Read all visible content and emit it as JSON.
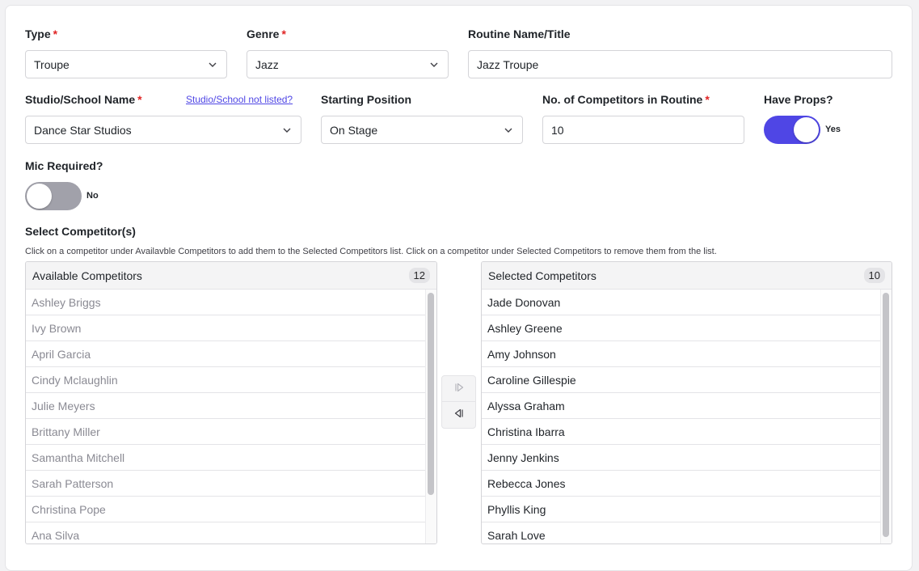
{
  "form": {
    "type": {
      "label": "Type",
      "required_mark": "*",
      "value": "Troupe"
    },
    "genre": {
      "label": "Genre",
      "required_mark": "*",
      "value": "Jazz"
    },
    "routine_name": {
      "label": "Routine Name/Title",
      "value": "Jazz Troupe"
    },
    "studio": {
      "label": "Studio/School Name",
      "required_mark": "*",
      "value": "Dance Star Studios",
      "not_listed_link": "Studio/School not listed?"
    },
    "starting_position": {
      "label": "Starting Position",
      "value": "On Stage"
    },
    "num_competitors": {
      "label": "No. of Competitors in Routine",
      "required_mark": "*",
      "value": "10"
    },
    "have_props": {
      "label": "Have Props?",
      "state": "Yes",
      "on": true,
      "color_on": "#4f46e5"
    },
    "mic_required": {
      "label": "Mic Required?",
      "state": "No",
      "on": false,
      "color_off": "#a1a1aa"
    }
  },
  "competitors": {
    "title": "Select Competitor(s)",
    "help": "Click on a competitor under Availavble Competitors to add them to the Selected Competitors list. Click on a competitor under Selected Competitors to remove them from the list.",
    "available": {
      "title": "Available Competitors",
      "count": "12",
      "items": [
        "Ashley Briggs",
        "Ivy Brown",
        "April Garcia",
        "Cindy Mclaughlin",
        "Julie Meyers",
        "Brittany Miller",
        "Samantha Mitchell",
        "Sarah Patterson",
        "Christina Pope",
        "Ana Silva"
      ]
    },
    "selected": {
      "title": "Selected Competitors",
      "count": "10",
      "items": [
        "Jade Donovan",
        "Ashley Greene",
        "Amy Johnson",
        "Caroline Gillespie",
        "Alyssa Graham",
        "Christina Ibarra",
        "Jenny Jenkins",
        "Rebecca Jones",
        "Phyllis King",
        "Sarah Love"
      ]
    },
    "move_right_icon": "move-right-icon",
    "move_left_icon": "move-left-icon"
  }
}
